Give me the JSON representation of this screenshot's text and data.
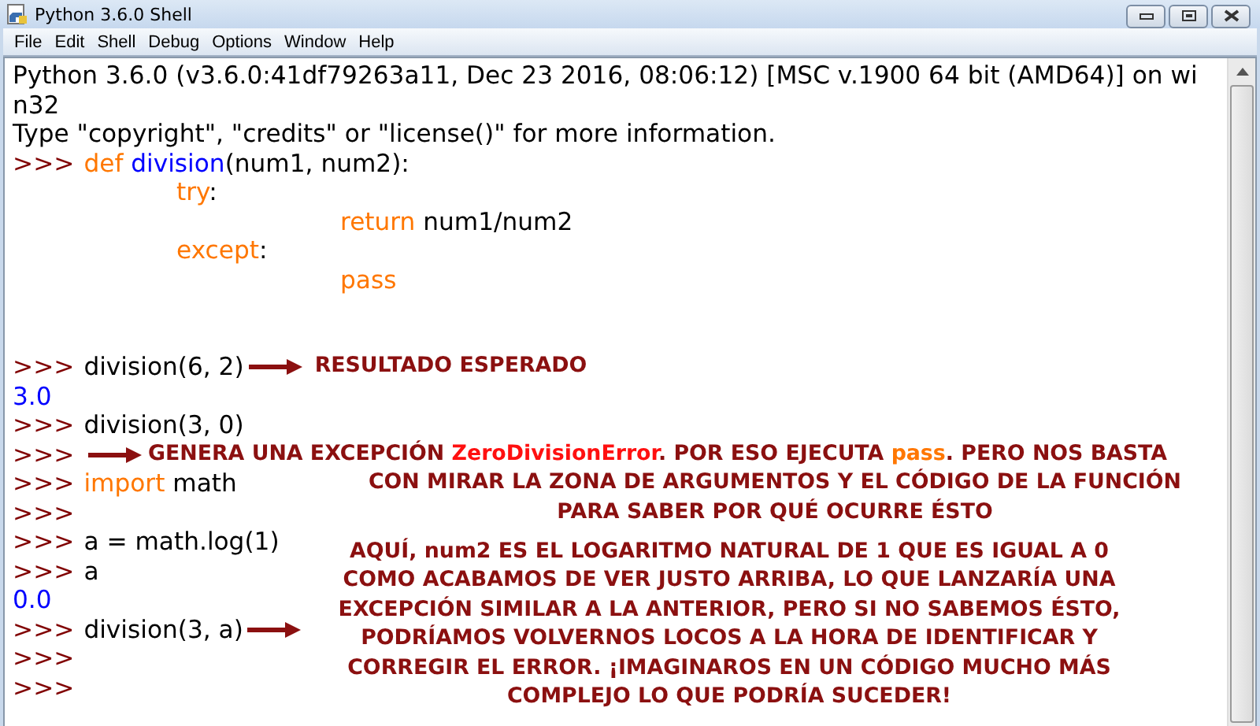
{
  "window": {
    "title": "Python 3.6.0 Shell"
  },
  "menu": [
    "File",
    "Edit",
    "Shell",
    "Debug",
    "Options",
    "Window",
    "Help"
  ],
  "lines": [
    {
      "segments": [
        {
          "kind": "plain",
          "text": "Python 3.6.0 (v3.6.0:41df79263a11, Dec 23 2016, 08:06:12) [MSC v.1900 64 bit (AMD64)] on wi"
        }
      ]
    },
    {
      "segments": [
        {
          "kind": "plain",
          "text": "n32"
        }
      ]
    },
    {
      "segments": [
        {
          "kind": "plain",
          "text": "Type \"copyright\", \"credits\" or \"license()\" for more information."
        }
      ]
    },
    {
      "prompt": ">>>",
      "segments": [
        {
          "kind": "keyword",
          "text": "def"
        },
        {
          "kind": "name",
          "text": " division"
        },
        {
          "kind": "plain",
          "text": "(num1, num2):"
        }
      ],
      "children": [
        {
          "segments": [
            {
              "kind": "keyword",
              "text": "try"
            },
            {
              "kind": "plain",
              "text": ":"
            }
          ],
          "children": [
            {
              "segments": [
                {
                  "kind": "keyword",
                  "text": "return"
                },
                {
                  "kind": "plain",
                  "text": " num1/num2"
                }
              ]
            }
          ]
        },
        {
          "segments": [
            {
              "kind": "keyword",
              "text": "except"
            },
            {
              "kind": "plain",
              "text": ":"
            }
          ],
          "children": [
            {
              "segments": [
                {
                  "kind": "keyword",
                  "text": "pass"
                }
              ]
            }
          ]
        }
      ]
    },
    {
      "prompt": ">>>",
      "segments": [
        {
          "kind": "plain",
          "text": "division(6, 2)"
        }
      ],
      "arrow": true,
      "note": {
        "kind": "inline",
        "lines": [
          [
            {
              "kind": "text",
              "text": "RESULTADO ESPERADO"
            }
          ]
        ]
      }
    },
    {
      "segments": [
        {
          "kind": "output",
          "text": "3.0"
        }
      ]
    },
    {
      "prompt": ">>>",
      "segments": [
        {
          "kind": "plain",
          "text": "division(3, 0)"
        }
      ]
    },
    {
      "prompt": ">>>",
      "arrow": true,
      "note": {
        "kind": "below",
        "lines": [
          [
            {
              "kind": "text",
              "text": "GENERA UNA EXCEPCIÓN "
            },
            {
              "kind": "error",
              "text": "ZeroDivisionError"
            },
            {
              "kind": "text",
              "text": ". POR ESO EJECUTA "
            },
            {
              "kind": "keyword",
              "text": "pass"
            },
            {
              "kind": "text",
              "text": ". PERO NOS BASTA"
            }
          ],
          [
            {
              "kind": "text",
              "text": "CON MIRAR LA ZONA DE ARGUMENTOS Y EL CÓDIGO DE LA FUNCIÓN"
            }
          ],
          [
            {
              "kind": "text",
              "text": "PARA SABER POR QUÉ OCURRE ÉSTO"
            }
          ]
        ]
      }
    },
    {
      "prompt": ">>>",
      "segments": [
        {
          "kind": "keyword",
          "text": "import"
        },
        {
          "kind": "plain",
          "text": " math"
        }
      ]
    },
    {
      "prompt": ">>>"
    },
    {
      "prompt": ">>>",
      "segments": [
        {
          "kind": "plain",
          "text": "a = math.log(1)"
        }
      ]
    },
    {
      "prompt": ">>>",
      "segments": [
        {
          "kind": "plain",
          "text": "a"
        }
      ]
    },
    {
      "segments": [
        {
          "kind": "output",
          "text": "0.0"
        }
      ]
    },
    {
      "prompt": ">>>",
      "segments": [
        {
          "kind": "plain",
          "text": "division(3, a)"
        }
      ],
      "arrow": true,
      "note": {
        "kind": "side",
        "lines": [
          [
            {
              "kind": "text",
              "text": "AQUÍ, num2 ES EL LOGARITMO NATURAL DE 1 QUE ES IGUAL A 0\nCOMO ACABAMOS DE VER JUSTO ARRIBA, LO QUE LANZARÍA UNA\nEXCEPCIÓN SIMILAR A LA ANTERIOR, PERO SI NO SABEMOS ÉSTO,\nPODRÍAMOS VOLVERNOS LOCOS A LA HORA DE IDENTIFICAR Y\nCORREGIR EL ERROR. ¡IMAGINAROS EN UN CÓDIGO MUCHO MÁS\nCOMPLEJO LO QUE PODRÍA SUCEDER!"
            }
          ]
        ]
      }
    },
    {
      "prompt": ">>>"
    },
    {
      "prompt": ">>>"
    }
  ]
}
